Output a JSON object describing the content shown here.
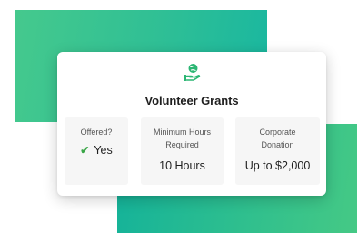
{
  "card": {
    "title": "Volunteer Grants",
    "icon": "hand-globe-icon",
    "columns": [
      {
        "label_lines": [
          "Offered?"
        ],
        "value": "Yes",
        "icon": "checkmark-icon",
        "icon_color": "#3aa648"
      },
      {
        "label_lines": [
          "Minimum Hours",
          "Required"
        ],
        "value": "10 Hours"
      },
      {
        "label_lines": [
          "Corporate",
          "Donation"
        ],
        "value": "Up to $2,000"
      }
    ]
  },
  "colors": {
    "accent_green": "#2fbf95",
    "icon_green": "#2bb673",
    "check_green": "#3aa648"
  }
}
